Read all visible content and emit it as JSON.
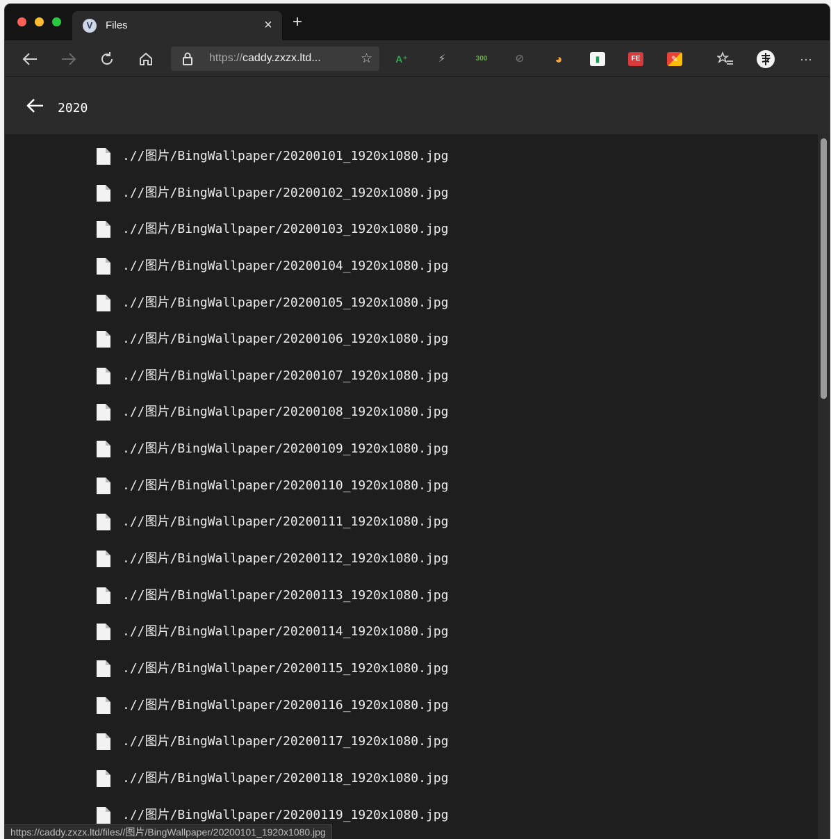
{
  "browser": {
    "tab": {
      "favicon": "V",
      "title": "Files",
      "close": "×"
    },
    "new_tab": "+",
    "address": {
      "scheme": "https://",
      "host": "caddy.zxzx.ltd..."
    },
    "extensions": [
      "A⁺",
      "⚡",
      "300",
      "⊘",
      "◕",
      "▮",
      "FE",
      "✎"
    ],
    "more": "···"
  },
  "app": {
    "search_value": "2020"
  },
  "files": [
    ".//图片/BingWallpaper/20200101_1920x1080.jpg",
    ".//图片/BingWallpaper/20200102_1920x1080.jpg",
    ".//图片/BingWallpaper/20200103_1920x1080.jpg",
    ".//图片/BingWallpaper/20200104_1920x1080.jpg",
    ".//图片/BingWallpaper/20200105_1920x1080.jpg",
    ".//图片/BingWallpaper/20200106_1920x1080.jpg",
    ".//图片/BingWallpaper/20200107_1920x1080.jpg",
    ".//图片/BingWallpaper/20200108_1920x1080.jpg",
    ".//图片/BingWallpaper/20200109_1920x1080.jpg",
    ".//图片/BingWallpaper/20200110_1920x1080.jpg",
    ".//图片/BingWallpaper/20200111_1920x1080.jpg",
    ".//图片/BingWallpaper/20200112_1920x1080.jpg",
    ".//图片/BingWallpaper/20200113_1920x1080.jpg",
    ".//图片/BingWallpaper/20200114_1920x1080.jpg",
    ".//图片/BingWallpaper/20200115_1920x1080.jpg",
    ".//图片/BingWallpaper/20200116_1920x1080.jpg",
    ".//图片/BingWallpaper/20200117_1920x1080.jpg",
    ".//图片/BingWallpaper/20200118_1920x1080.jpg",
    ".//图片/BingWallpaper/20200119_1920x1080.jpg"
  ],
  "status_url": "https://caddy.zxzx.ltd/files//图片/BingWallpaper/20200101_1920x1080.jpg",
  "colors": {
    "background": "#1e1e1e",
    "toolbar": "#2b2b2b",
    "text": "#ececec"
  }
}
